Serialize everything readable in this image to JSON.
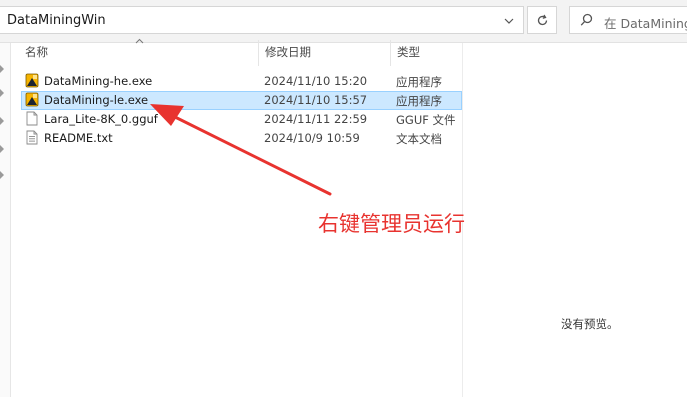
{
  "address_bar": {
    "path": "DataMiningWin"
  },
  "search": {
    "placeholder": "在 DataMiningW"
  },
  "columns": {
    "name": "名称",
    "date": "修改日期",
    "type": "类型"
  },
  "files": [
    {
      "name": "DataMining-he.exe",
      "date": "2024/11/10 15:20",
      "type": "应用程序",
      "icon": "exe-icon",
      "selected": false
    },
    {
      "name": "DataMining-le.exe",
      "date": "2024/11/10 15:57",
      "type": "应用程序",
      "icon": "exe-icon",
      "selected": true
    },
    {
      "name": "Lara_Lite-8K_0.gguf",
      "date": "2024/11/11 22:59",
      "type": "GGUF 文件",
      "icon": "file-icon",
      "selected": false
    },
    {
      "name": "README.txt",
      "date": "2024/10/9 10:59",
      "type": "文本文档",
      "icon": "text-file-icon",
      "selected": false
    }
  ],
  "preview": {
    "empty_text": "没有预览。"
  },
  "annotation": {
    "text": "右键管理员运行",
    "color": "#e8332f"
  },
  "colors": {
    "selection": "#cce8ff",
    "selection_border": "#99d1ff"
  }
}
